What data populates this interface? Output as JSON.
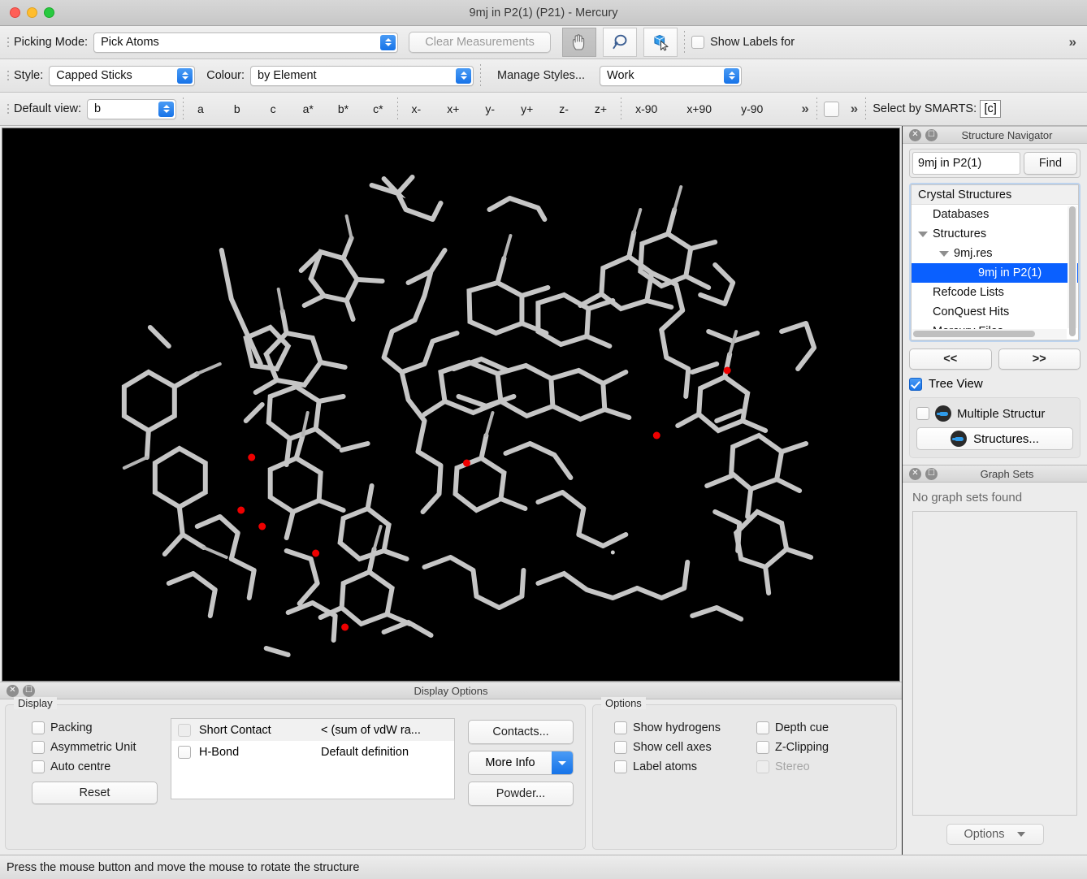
{
  "window": {
    "title": "9mj in P2(1) (P21) - Mercury",
    "traffic_lights": [
      "close",
      "minimize",
      "zoom"
    ]
  },
  "toolbar1": {
    "picking_mode_label": "Picking Mode:",
    "picking_mode_value": "Pick Atoms",
    "clear_measurements": "Clear Measurements",
    "icons": [
      "hand-icon",
      "lasso-icon",
      "pick-molecule-icon"
    ],
    "show_labels_for": "Show Labels for",
    "show_labels_checked": false,
    "overflow": "»"
  },
  "toolbar2": {
    "style_label": "Style:",
    "style_value": "Capped Sticks",
    "colour_label": "Colour:",
    "colour_value": "by Element",
    "manage_styles": "Manage Styles...",
    "scheme_value": "Work"
  },
  "toolbar3": {
    "default_view_label": "Default view:",
    "default_view_value": "b",
    "axis_buttons": [
      "a",
      "b",
      "c",
      "a*",
      "b*",
      "c*"
    ],
    "rotate_buttons": [
      "x-",
      "x+",
      "y-",
      "y+",
      "z-",
      "z+"
    ],
    "angle_buttons": [
      "x-90",
      "x+90",
      "y-90"
    ],
    "overflow1": "»",
    "overflow2": "»",
    "smarts_label": "Select by SMARTS:",
    "smarts_value": "[c]"
  },
  "navigator": {
    "panel_title": "Structure Navigator",
    "search_value": "9mj in P2(1)",
    "find_label": "Find",
    "tree_header": "Crystal Structures",
    "tree_items": [
      {
        "label": "Databases",
        "indent": 1,
        "twisty": false,
        "selected": false
      },
      {
        "label": "Structures",
        "indent": 1,
        "twisty": true,
        "selected": false
      },
      {
        "label": "9mj.res",
        "indent": 2,
        "twisty": true,
        "selected": false
      },
      {
        "label": "9mj in P2(1)",
        "indent": 3,
        "twisty": false,
        "selected": true
      },
      {
        "label": "Refcode Lists",
        "indent": 1,
        "twisty": false,
        "selected": false
      },
      {
        "label": "ConQuest Hits",
        "indent": 1,
        "twisty": false,
        "selected": false
      },
      {
        "label": "Mercury Files",
        "indent": 1,
        "twisty": false,
        "selected": false
      }
    ],
    "prev_label": "<<",
    "next_label": ">>",
    "tree_view_label": "Tree View",
    "tree_view_checked": true,
    "multiple_structures_label": "Multiple Structur",
    "multiple_structures_checked": false,
    "structures_button": "Structures..."
  },
  "graphsets": {
    "panel_title": "Graph Sets",
    "empty_message": "No graph sets found",
    "options_label": "Options"
  },
  "display_options": {
    "panel_title": "Display Options",
    "display_group_label": "Display",
    "checkboxes": [
      {
        "label": "Packing",
        "checked": false
      },
      {
        "label": "Asymmetric Unit",
        "checked": false
      },
      {
        "label": "Auto centre",
        "checked": false
      }
    ],
    "reset_label": "Reset",
    "contacts_rows": [
      {
        "name": "Short Contact",
        "definition": "< (sum of vdW ra...",
        "checked": false
      },
      {
        "name": "H-Bond",
        "definition": "Default definition",
        "checked": false
      }
    ],
    "buttons": {
      "contacts": "Contacts...",
      "more_info": "More Info",
      "powder": "Powder..."
    },
    "options_group_label": "Options",
    "option_checkboxes": [
      {
        "label": "Show hydrogens",
        "checked": false,
        "disabled": false
      },
      {
        "label": "Depth cue",
        "checked": false,
        "disabled": false
      },
      {
        "label": "Show cell axes",
        "checked": false,
        "disabled": false
      },
      {
        "label": "Z-Clipping",
        "checked": false,
        "disabled": false
      },
      {
        "label": "Label atoms",
        "checked": false,
        "disabled": false
      },
      {
        "label": "Stereo",
        "checked": false,
        "disabled": true
      }
    ]
  },
  "statusbar": {
    "message": "Press the mouse button and move the mouse to rotate the structure"
  },
  "viewport": {
    "background": "#000000",
    "bond_color": "#c8c8c8",
    "oxygen_color": "#ee0000",
    "style": "Capped Sticks",
    "colour_scheme": "by Element"
  }
}
